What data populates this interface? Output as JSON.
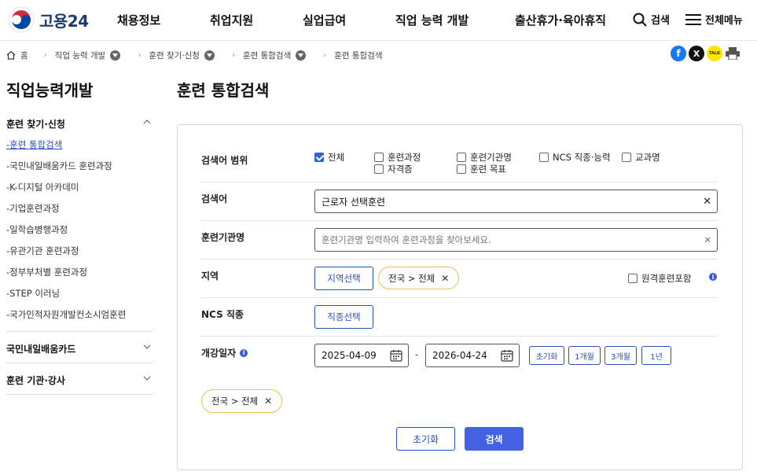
{
  "header": {
    "logo_text": "고용24",
    "nav": [
      "채용정보",
      "취업지원",
      "실업급여",
      "직업 능력 개발",
      "출산휴가·육아휴직"
    ],
    "search_label": "검색",
    "menu_label": "전체메뉴"
  },
  "breadcrumb": {
    "home": "홈",
    "items": [
      "직업 능력 개발",
      "훈련 찾기·신청",
      "훈련 통합검색",
      "훈련 통합검색"
    ]
  },
  "share": {
    "facebook": "f",
    "x": "X",
    "kakao": "TALK",
    "icons": [
      "facebook-icon",
      "x-icon",
      "kakaotalk-icon",
      "print-icon"
    ]
  },
  "sidebar": {
    "title": "직업능력개발",
    "section1": "훈련 찾기·신청",
    "items": [
      "-훈련 통합검색",
      "-국민내일배움카드 훈련과정",
      "-K-디지털 아카데미",
      "-기업훈련과정",
      "-일학습병행과정",
      "-유관기관 훈련과정",
      "-정부부처별 훈련과정",
      "-STEP 이러닝",
      "-국가인적자원개발컨소시엄훈련"
    ],
    "section2": "국민내일배움카드",
    "section3": "훈련 기관·강사"
  },
  "main": {
    "title": "훈련 통합검색",
    "scope": {
      "label": "검색어 범위",
      "options": [
        {
          "label": "전체",
          "checked": true
        },
        {
          "label": "훈련과정",
          "checked": false
        },
        {
          "label": "훈련기관명",
          "checked": false
        },
        {
          "label": "NCS 직종·능력",
          "checked": false
        },
        {
          "label": "교과명",
          "checked": false
        },
        {
          "label": "자격증",
          "checked": false
        },
        {
          "label": "훈련 목표",
          "checked": false
        }
      ]
    },
    "keyword": {
      "label": "검색어",
      "value": "근로자 선택훈련"
    },
    "institution": {
      "label": "훈련기관명",
      "placeholder": "훈련기관명 입력하여 훈련과정을 찾아보세요."
    },
    "region": {
      "label": "지역",
      "button": "지역선택",
      "chip": "전국 > 전체",
      "remote_label": "원격훈련포함"
    },
    "ncs": {
      "label": "NCS 직종",
      "button": "직종선택"
    },
    "date": {
      "label": "개강일자",
      "start": "2025-04-09",
      "separator": "-",
      "end": "2026-04-24",
      "quick": [
        "초기화",
        "1개월",
        "3개월",
        "1년"
      ]
    },
    "selected_chip": "전국 > 전체",
    "actions": {
      "reset": "초기화",
      "search": "검색"
    }
  }
}
